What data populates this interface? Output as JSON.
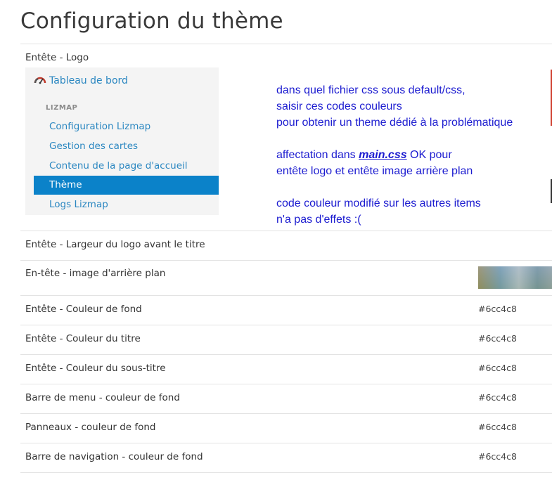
{
  "page": {
    "title": "Configuration du thème"
  },
  "logo_section": {
    "label": "Entête - Logo"
  },
  "menu": {
    "dashboard": "Tableau de bord",
    "section": "LIZMAP",
    "items": [
      {
        "label": "Configuration Lizmap",
        "active": false
      },
      {
        "label": "Gestion des cartes",
        "active": false
      },
      {
        "label": "Contenu de la page d'accueil",
        "active": false
      },
      {
        "label": "Thème",
        "active": true
      },
      {
        "label": "Logs Lizmap",
        "active": false
      }
    ],
    "colors": {
      "link": "#2b87c1",
      "active_bg": "#0b82c9"
    }
  },
  "annotation": {
    "color": "#1c1cd0",
    "line1": "dans quel fichier css sous default/css,",
    "line2": "saisir ces codes couleurs",
    "line3": "pour obtenir un theme dédié à la problématique",
    "line4_pre": "affectation dans ",
    "line4_file": "main.css",
    "line4_post": " OK pour",
    "line5": "entête logo et  entête image arrière plan",
    "line6": "code couleur modifié sur les autres items",
    "line7": "n'a pas d'effets :("
  },
  "rows": [
    {
      "label": "Entête - Largeur du logo avant le titre",
      "value": ""
    },
    {
      "label": "En-tête - image d'arrière plan",
      "value": ""
    },
    {
      "label": "Entête - Couleur de fond",
      "value": "#6cc4c8"
    },
    {
      "label": "Entête - Couleur du titre",
      "value": "#6cc4c8"
    },
    {
      "label": "Entête - Couleur du sous-titre",
      "value": "#6cc4c8"
    },
    {
      "label": "Barre de menu - couleur de fond",
      "value": "#6cc4c8"
    },
    {
      "label": "Panneaux - couleur de fond",
      "value": "#6cc4c8"
    },
    {
      "label": "Barre de navigation - couleur de fond",
      "value": "#6cc4c8"
    }
  ]
}
